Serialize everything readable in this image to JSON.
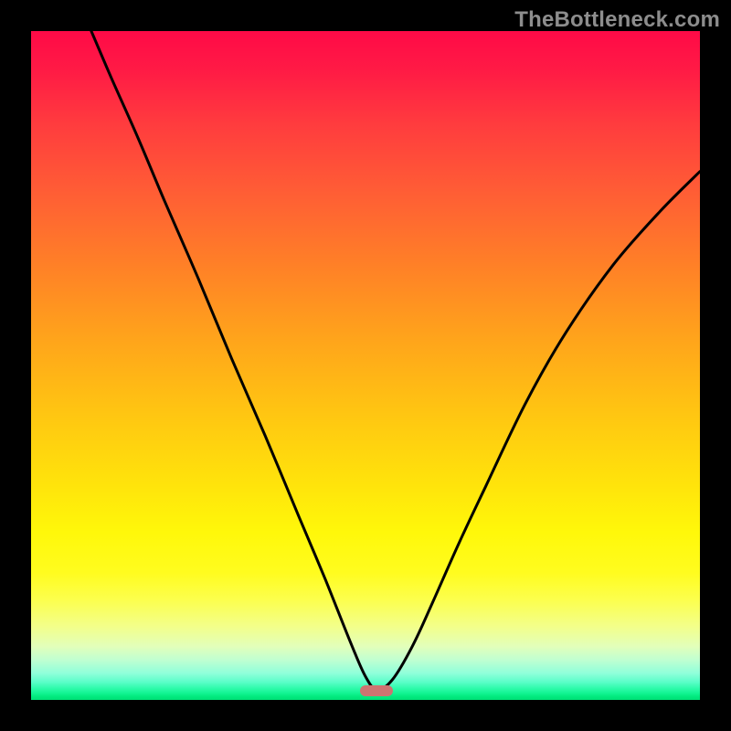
{
  "watermark": "TheBottleneck.com",
  "marker": {
    "x_frac": 0.517,
    "y_frac": 0.986,
    "color": "#cd7471"
  },
  "chart_data": {
    "type": "line",
    "title": "",
    "xlabel": "",
    "ylabel": "",
    "xlim": [
      0,
      1
    ],
    "ylim": [
      0,
      1
    ],
    "grid": false,
    "series": [
      {
        "name": "bottleneck-curve",
        "x": [
          0.09,
          0.12,
          0.16,
          0.2,
          0.25,
          0.3,
          0.35,
          0.4,
          0.44,
          0.48,
          0.5,
          0.517,
          0.54,
          0.57,
          0.6,
          0.64,
          0.68,
          0.74,
          0.8,
          0.87,
          0.94,
          1.0
        ],
        "y": [
          1.0,
          0.93,
          0.84,
          0.745,
          0.63,
          0.51,
          0.395,
          0.275,
          0.18,
          0.08,
          0.035,
          0.015,
          0.03,
          0.08,
          0.145,
          0.235,
          0.32,
          0.445,
          0.55,
          0.65,
          0.73,
          0.79
        ]
      }
    ],
    "annotations": []
  }
}
